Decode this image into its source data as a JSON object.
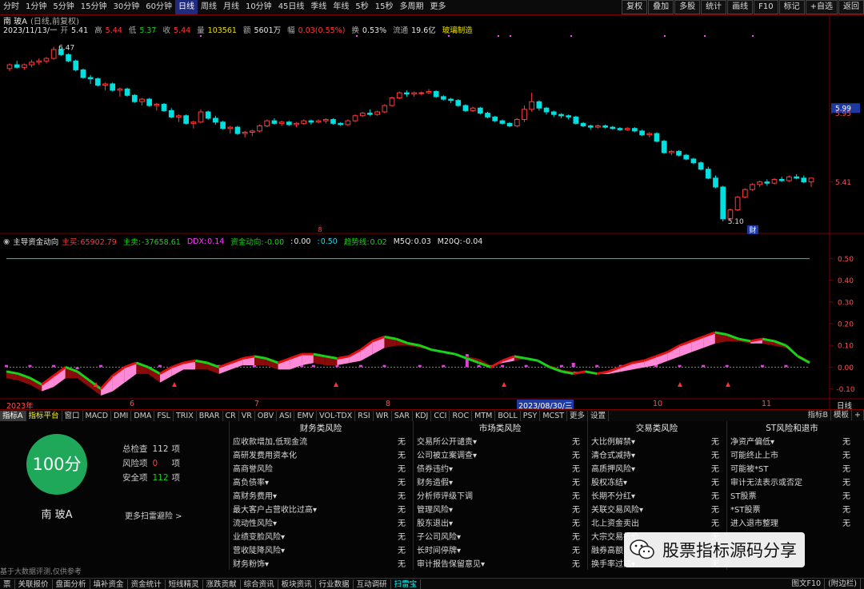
{
  "periods": [
    "分时",
    "1分钟",
    "5分钟",
    "15分钟",
    "30分钟",
    "60分钟",
    "日线",
    "周线",
    "月线",
    "10分钟",
    "45日线",
    "季线",
    "年线",
    "5秒",
    "15秒",
    "多周期",
    "更多"
  ],
  "active_period": 6,
  "tools": [
    "复权",
    "叠加",
    "多股",
    "统计",
    "画线",
    "F10",
    "标记",
    "+自选",
    "返回"
  ],
  "title": {
    "name": "南 玻A",
    "mode": "(日线,前复权)"
  },
  "info": {
    "date": "2023/11/13/一",
    "open_label": "开",
    "open": "5.41",
    "high_label": "高",
    "high": "5.44",
    "low_label": "低",
    "low": "5.37",
    "close_label": "收",
    "close": "5.44",
    "vol_label": "量",
    "vol": "103561",
    "amt_label": "额",
    "amt": "5601万",
    "chg_label": "幅",
    "chg": "0.03(0.55%)",
    "turn_label": "换",
    "turn": "0.53%",
    "float_label": "流通",
    "float": "19.6亿",
    "industry": "玻璃制造"
  },
  "price_axis": [
    "5.99",
    "5.95",
    "5.41"
  ],
  "price_marks": {
    "high": "6.47",
    "low": "5.10",
    "event": "财",
    "signal": "8"
  },
  "indicator": {
    "name": "主导资金动向",
    "items": [
      {
        "label": "主买:",
        "value": "65902.79",
        "color": "#ff3b3b"
      },
      {
        "label": "主卖:",
        "value": "-37658.61",
        "color": "#19d219"
      },
      {
        "label": "DDX:",
        "value": "0.14",
        "color": "#ff40ff"
      },
      {
        "label": "资金动向:",
        "value": "-0.00",
        "color": "#19d219"
      },
      {
        "label": ":",
        "value": "0.00",
        "color": "#e8e8e8"
      },
      {
        "label": ":",
        "value": "0.50",
        "color": "#29d8e8"
      },
      {
        "label": "趋势线:",
        "value": "0.02",
        "color": "#19d219"
      },
      {
        "label": "M5Q:",
        "value": "0.03",
        "color": "#e8e8e8"
      },
      {
        "label": "M20Q:",
        "value": "-0.04",
        "color": "#e8e8e8"
      }
    ]
  },
  "indicator_axis": [
    "0.50",
    "0.40",
    "0.30",
    "0.20",
    "0.10",
    "0.00",
    "-0.10"
  ],
  "date_axis": {
    "labels": [
      "2023年",
      "6",
      "7",
      "8",
      "10",
      "11"
    ],
    "cursor": "2023/08/30/三",
    "right": "日线"
  },
  "indicator_tabs": [
    "指标A",
    "指标平台",
    "窗口",
    "MACD",
    "DMI",
    "DMA",
    "FSL",
    "TRIX",
    "BRAR",
    "CR",
    "VR",
    "OBV",
    "ASI",
    "EMV",
    "VOL-TDX",
    "RSI",
    "WR",
    "SAR",
    "KDJ",
    "CCI",
    "ROC",
    "MTM",
    "BOLL",
    "PSY",
    "MCST",
    "更多",
    "设置"
  ],
  "indicator_tabs_right": [
    "指标B",
    "模板",
    "+"
  ],
  "score": {
    "text": "100分",
    "stock": "南 玻A",
    "color": "#1fa85a"
  },
  "stats": [
    {
      "label": "总检查",
      "value": "112",
      "unit": "项",
      "color": "#d0d0d0"
    },
    {
      "label": "风险项",
      "value": "0",
      "unit": "项",
      "color": "#ff3b3b"
    },
    {
      "label": "安全项",
      "value": "112",
      "unit": "项",
      "color": "#19d219"
    }
  ],
  "more_scan": "更多扫雷避险 >",
  "disclaimer": "基于大数据评测,仅供参考",
  "risk_columns": [
    {
      "title": "财务类风险",
      "rows": [
        {
          "label": "应收款增加,低现金流",
          "value": "无"
        },
        {
          "label": "高研发费用资本化",
          "value": "无"
        },
        {
          "label": "高商誉风险",
          "value": "无"
        },
        {
          "label": "高负债率▾",
          "value": "无"
        },
        {
          "label": "高财务费用▾",
          "value": "无"
        },
        {
          "label": "最大客户占营收比过高▾",
          "value": "无"
        },
        {
          "label": "流动性风险▾",
          "value": "无"
        },
        {
          "label": "业绩变脸风险▾",
          "value": "无"
        },
        {
          "label": "营收陡降风险▾",
          "value": "无"
        },
        {
          "label": "财务粉饰▾",
          "value": "无"
        }
      ]
    },
    {
      "title": "市场类风险",
      "rows": [
        {
          "label": "交易所公开谴责▾",
          "value": "无"
        },
        {
          "label": "公司被立案调查▾",
          "value": "无"
        },
        {
          "label": "债券违约▾",
          "value": "无"
        },
        {
          "label": "财务造假▾",
          "value": "无"
        },
        {
          "label": "分析师评级下调",
          "value": "无"
        },
        {
          "label": "管理风险▾",
          "value": "无"
        },
        {
          "label": "股东退出▾",
          "value": "无"
        },
        {
          "label": "子公司风险▾",
          "value": "无"
        },
        {
          "label": "长时间停牌▾",
          "value": "无"
        },
        {
          "label": "审计报告保留意见▾",
          "value": "无"
        }
      ]
    },
    {
      "title": "交易类风险",
      "rows": [
        {
          "label": "大比例解禁▾",
          "value": "无"
        },
        {
          "label": "清仓式减持▾",
          "value": "无"
        },
        {
          "label": "高质押风险▾",
          "value": "无"
        },
        {
          "label": "股权冻结▾",
          "value": "无"
        },
        {
          "label": "长期不分红▾",
          "value": "无"
        },
        {
          "label": "关联交易风险▾",
          "value": "无"
        },
        {
          "label": "北上资金卖出",
          "value": "无"
        },
        {
          "label": "大宗交易折价",
          "value": "无"
        },
        {
          "label": "融券高额",
          "value": "无"
        },
        {
          "label": "换手率过高▾",
          "value": "无"
        }
      ]
    },
    {
      "title": "ST风险和退市",
      "rows": [
        {
          "label": "净资产偏低▾",
          "value": "无"
        },
        {
          "label": "可能终止上市",
          "value": "无"
        },
        {
          "label": "可能被*ST",
          "value": "无"
        },
        {
          "label": "审计无法表示或否定",
          "value": "无"
        },
        {
          "label": "ST股票",
          "value": "无"
        },
        {
          "label": "*ST股票",
          "value": "无"
        },
        {
          "label": "进入退市整理",
          "value": "无"
        },
        {
          "label": "",
          "value": ""
        },
        {
          "label": "",
          "value": ""
        },
        {
          "label": "",
          "value": ""
        }
      ]
    }
  ],
  "bottom_tabs": [
    "票",
    "关联报价",
    "盘面分析",
    "填补资金",
    "资金统计",
    "短线精灵",
    "涨跌贡献",
    "综合资讯",
    "板块资讯",
    "行业数据",
    "互动调研",
    "扫雷宝"
  ],
  "bottom_active": 11,
  "bottom_right": [
    "图文F10",
    "(附边栏)"
  ],
  "watermark": "股票指标源码分享",
  "colors": {
    "up": "#ff3b3b",
    "down": "#00e0e0",
    "axis": "#7a0000"
  },
  "chart_data": {
    "type": "candlestick",
    "candles": [
      [
        6.3,
        6.34,
        6.28,
        6.33
      ],
      [
        6.33,
        6.36,
        6.3,
        6.31
      ],
      [
        6.31,
        6.34,
        6.29,
        6.33
      ],
      [
        6.33,
        6.37,
        6.31,
        6.35
      ],
      [
        6.35,
        6.38,
        6.33,
        6.36
      ],
      [
        6.36,
        6.39,
        6.34,
        6.38
      ],
      [
        6.38,
        6.47,
        6.37,
        6.45
      ],
      [
        6.45,
        6.46,
        6.4,
        6.41
      ],
      [
        6.41,
        6.42,
        6.35,
        6.36
      ],
      [
        6.36,
        6.37,
        6.28,
        6.29
      ],
      [
        6.29,
        6.3,
        6.22,
        6.23
      ],
      [
        6.23,
        6.25,
        6.18,
        6.22
      ],
      [
        6.22,
        6.23,
        6.16,
        6.17
      ],
      [
        6.17,
        6.19,
        6.13,
        6.18
      ],
      [
        6.18,
        6.19,
        6.12,
        6.13
      ],
      [
        6.13,
        6.15,
        6.08,
        6.14
      ],
      [
        6.14,
        6.15,
        6.08,
        6.09
      ],
      [
        6.09,
        6.1,
        6.03,
        6.04
      ],
      [
        6.04,
        6.07,
        6.01,
        6.06
      ],
      [
        6.06,
        6.07,
        6.0,
        6.01
      ],
      [
        6.01,
        6.03,
        5.97,
        6.02
      ],
      [
        6.02,
        6.03,
        5.96,
        5.97
      ],
      [
        5.97,
        5.99,
        5.91,
        5.92
      ],
      [
        5.92,
        5.94,
        5.88,
        5.93
      ],
      [
        5.93,
        5.94,
        5.86,
        5.87
      ],
      [
        5.87,
        5.89,
        5.83,
        5.88
      ],
      [
        5.88,
        5.98,
        5.87,
        5.96
      ],
      [
        5.96,
        5.97,
        5.9,
        5.91
      ],
      [
        5.91,
        5.93,
        5.86,
        5.88
      ],
      [
        5.88,
        5.89,
        5.82,
        5.83
      ],
      [
        5.83,
        5.85,
        5.79,
        5.84
      ],
      [
        5.84,
        5.85,
        5.78,
        5.79
      ],
      [
        5.79,
        5.81,
        5.76,
        5.8
      ],
      [
        5.8,
        5.82,
        5.77,
        5.81
      ],
      [
        5.81,
        5.86,
        5.8,
        5.85
      ],
      [
        5.85,
        5.9,
        5.84,
        5.89
      ],
      [
        5.89,
        5.91,
        5.86,
        5.87
      ],
      [
        5.87,
        5.89,
        5.85,
        5.88
      ],
      [
        5.88,
        5.89,
        5.85,
        5.86
      ],
      [
        5.86,
        5.88,
        5.84,
        5.87
      ],
      [
        5.87,
        5.9,
        5.86,
        5.89
      ],
      [
        5.89,
        5.9,
        5.86,
        5.88
      ],
      [
        5.88,
        5.9,
        5.87,
        5.89
      ],
      [
        5.89,
        5.91,
        5.87,
        5.9
      ],
      [
        5.9,
        5.91,
        5.86,
        5.87
      ],
      [
        5.87,
        5.88,
        5.85,
        5.86
      ],
      [
        5.86,
        5.9,
        5.85,
        5.89
      ],
      [
        5.89,
        5.94,
        5.88,
        5.93
      ],
      [
        5.93,
        5.96,
        5.92,
        5.95
      ],
      [
        5.95,
        5.98,
        5.93,
        5.94
      ],
      [
        5.94,
        5.97,
        5.93,
        5.96
      ],
      [
        5.96,
        6.02,
        5.95,
        6.01
      ],
      [
        6.01,
        6.08,
        6.0,
        6.07
      ],
      [
        6.07,
        6.12,
        6.06,
        6.11
      ],
      [
        6.11,
        6.13,
        6.08,
        6.1
      ],
      [
        6.1,
        6.12,
        6.08,
        6.11
      ],
      [
        6.11,
        6.12,
        6.09,
        6.11
      ],
      [
        6.11,
        6.14,
        6.1,
        6.12
      ],
      [
        6.12,
        6.13,
        6.07,
        6.08
      ],
      [
        6.08,
        6.09,
        6.05,
        6.06
      ],
      [
        6.06,
        6.07,
        6.03,
        6.05
      ],
      [
        6.05,
        6.06,
        6.0,
        6.01
      ],
      [
        6.01,
        6.02,
        5.96,
        5.97
      ],
      [
        5.97,
        6.0,
        5.96,
        5.99
      ],
      [
        5.99,
        6.0,
        5.94,
        5.95
      ],
      [
        5.95,
        5.96,
        5.91,
        5.92
      ],
      [
        5.92,
        5.93,
        5.88,
        5.89
      ],
      [
        5.89,
        5.9,
        5.86,
        5.87
      ],
      [
        5.87,
        5.88,
        5.84,
        5.85
      ],
      [
        5.85,
        5.91,
        5.84,
        5.9
      ],
      [
        5.9,
        6.01,
        5.88,
        5.98
      ],
      [
        5.98,
        6.11,
        5.96,
        6.04
      ],
      [
        6.04,
        6.05,
        5.97,
        5.99
      ],
      [
        5.99,
        6.0,
        5.94,
        5.96
      ],
      [
        5.96,
        5.97,
        5.92,
        5.94
      ],
      [
        5.94,
        5.95,
        5.91,
        5.93
      ],
      [
        5.93,
        5.94,
        5.9,
        5.92
      ],
      [
        5.92,
        5.93,
        5.86,
        5.87
      ],
      [
        5.87,
        5.88,
        5.84,
        5.85
      ],
      [
        5.85,
        5.86,
        5.82,
        5.84
      ],
      [
        5.84,
        5.86,
        5.83,
        5.85
      ],
      [
        5.85,
        5.86,
        5.83,
        5.84
      ],
      [
        5.84,
        5.85,
        5.82,
        5.83
      ],
      [
        5.83,
        5.84,
        5.81,
        5.82
      ],
      [
        5.82,
        5.84,
        5.81,
        5.83
      ],
      [
        5.83,
        5.84,
        5.8,
        5.81
      ],
      [
        5.81,
        5.82,
        5.77,
        5.78
      ],
      [
        5.78,
        5.8,
        5.76,
        5.79
      ],
      [
        5.79,
        5.8,
        5.72,
        5.73
      ],
      [
        5.73,
        5.74,
        5.63,
        5.64
      ],
      [
        5.64,
        5.66,
        5.62,
        5.65
      ],
      [
        5.65,
        5.66,
        5.61,
        5.62
      ],
      [
        5.62,
        5.63,
        5.58,
        5.59
      ],
      [
        5.59,
        5.6,
        5.55,
        5.56
      ],
      [
        5.56,
        5.57,
        5.5,
        5.51
      ],
      [
        5.51,
        5.53,
        5.43,
        5.44
      ],
      [
        5.44,
        5.46,
        5.36,
        5.37
      ],
      [
        5.37,
        5.38,
        5.1,
        5.12
      ],
      [
        5.12,
        5.2,
        5.11,
        5.19
      ],
      [
        5.19,
        5.3,
        5.18,
        5.29
      ],
      [
        5.29,
        5.36,
        5.28,
        5.35
      ],
      [
        5.35,
        5.4,
        5.34,
        5.39
      ],
      [
        5.39,
        5.42,
        5.37,
        5.41
      ],
      [
        5.41,
        5.43,
        5.38,
        5.4
      ],
      [
        5.4,
        5.44,
        5.39,
        5.43
      ],
      [
        5.43,
        5.45,
        5.41,
        5.42
      ],
      [
        5.42,
        5.46,
        5.41,
        5.45
      ],
      [
        5.45,
        5.47,
        5.43,
        5.44
      ],
      [
        5.44,
        5.46,
        5.4,
        5.41
      ],
      [
        5.41,
        5.44,
        5.37,
        5.44
      ]
    ],
    "ylim": [
      5.05,
      6.55
    ],
    "indicator": {
      "ylim": [
        -0.12,
        0.55
      ],
      "ref_line": 0.5,
      "band_upper": [
        -0.02,
        -0.03,
        -0.05,
        -0.08,
        -0.04,
        0.0,
        -0.02,
        -0.06,
        -0.1,
        -0.04,
        0.0,
        0.02,
        0.0,
        -0.03,
        0.0,
        0.02,
        0.03,
        0.02,
        0.0,
        0.02,
        0.04,
        0.05,
        0.04,
        0.02,
        0.04,
        0.06,
        0.06,
        0.05,
        0.04,
        0.05,
        0.08,
        0.12,
        0.14,
        0.13,
        0.11,
        0.1,
        0.08,
        0.07,
        0.06,
        0.04,
        0.02,
        0.0,
        0.03,
        0.05,
        0.04,
        0.03,
        0.0,
        -0.02,
        -0.03,
        -0.02,
        -0.03,
        -0.02,
        0.0,
        0.02,
        0.03,
        0.05,
        0.07,
        0.1,
        0.12,
        0.14,
        0.16,
        0.15,
        0.13,
        0.12,
        0.13,
        0.12,
        0.1,
        0.05,
        0.02
      ],
      "band_lower": [
        -0.04,
        -0.05,
        -0.07,
        -0.1,
        -0.08,
        -0.04,
        -0.04,
        -0.08,
        -0.12,
        -0.1,
        -0.06,
        -0.02,
        -0.02,
        -0.06,
        -0.03,
        0.0,
        0.0,
        0.0,
        -0.02,
        0.0,
        0.02,
        0.02,
        0.02,
        0.0,
        0.0,
        0.02,
        0.03,
        0.02,
        0.02,
        0.03,
        0.04,
        0.07,
        0.1,
        0.11,
        0.11,
        0.1,
        0.09,
        0.08,
        0.07,
        0.06,
        0.05,
        0.02,
        0.03,
        0.04,
        0.05,
        0.04,
        0.02,
        0.0,
        -0.01,
        -0.01,
        -0.02,
        -0.02,
        -0.01,
        0.0,
        0.01,
        0.02,
        0.04,
        0.06,
        0.08,
        0.1,
        0.12,
        0.13,
        0.13,
        0.12,
        0.12,
        0.11,
        0.1,
        0.07,
        0.04
      ],
      "ddx": [
        0.01,
        0.0,
        0.01,
        0.0,
        0.01,
        0.0,
        -0.01,
        0.0,
        0.01,
        0.0,
        0.0,
        0.01,
        0.0,
        0.01,
        0.0,
        0.0,
        0.01,
        0.0,
        0.01,
        0.02,
        0.0,
        0.01,
        0.0,
        0.01,
        0.01,
        0.02,
        0.01,
        0.0,
        0.01,
        0.0,
        0.01,
        0.0,
        0.01,
        0.0,
        0.0,
        0.01,
        0.0,
        0.01,
        0.0,
        0.06,
        0.01,
        0.0,
        0.01,
        0.0,
        0.01,
        0.0,
        0.0,
        0.01,
        0.02,
        0.0,
        0.01,
        0.0,
        0.01,
        0.0,
        0.01,
        0.02,
        0.0,
        0.01,
        0.0,
        0.01,
        0.0,
        0.01,
        0.0,
        0.0,
        0.01,
        0.0,
        0.01,
        0.0,
        0.0
      ]
    }
  }
}
